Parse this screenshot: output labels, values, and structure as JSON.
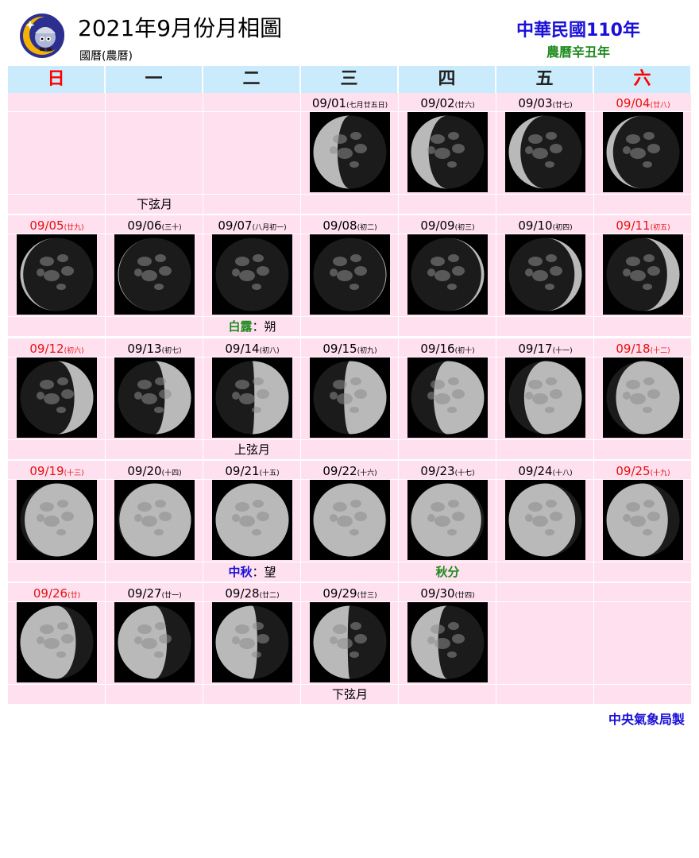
{
  "header": {
    "title": "2021年9月份月相圖",
    "subtitle": "國曆(農曆)",
    "roc_year": "中華民國110年",
    "lunar_year": "農曆辛丑年"
  },
  "weekdays": [
    {
      "label": "日",
      "weekend": true
    },
    {
      "label": "一",
      "weekend": false
    },
    {
      "label": "二",
      "weekend": false
    },
    {
      "label": "三",
      "weekend": false
    },
    {
      "label": "四",
      "weekend": false
    },
    {
      "label": "五",
      "weekend": false
    },
    {
      "label": "六",
      "weekend": true
    }
  ],
  "colors": {
    "header_bg": "#c9ebfb",
    "cell_bg": "#ffe0ef",
    "weekend_red": "#e81010",
    "title_blue": "#1a10d8",
    "green": "#1e8a1e"
  },
  "weeks": [
    [
      {
        "date": "",
        "lunar": "",
        "illum": null,
        "waxing": null,
        "event": ""
      },
      {
        "date": "",
        "lunar": "",
        "illum": null,
        "waxing": null,
        "event": "下弦月"
      },
      {
        "date": "",
        "lunar": "",
        "illum": null,
        "waxing": null,
        "event": ""
      },
      {
        "date": "09/01",
        "lunar": "七月廿五日",
        "illum": 0.33,
        "waxing": false,
        "event": ""
      },
      {
        "date": "09/02",
        "lunar": "廿六",
        "illum": 0.24,
        "waxing": false,
        "event": ""
      },
      {
        "date": "09/03",
        "lunar": "廿七",
        "illum": 0.16,
        "waxing": false,
        "event": ""
      },
      {
        "date": "09/04",
        "lunar": "廿八",
        "illum": 0.09,
        "waxing": false,
        "event": ""
      }
    ],
    [
      {
        "date": "09/05",
        "lunar": "廿九",
        "illum": 0.04,
        "waxing": false,
        "event": ""
      },
      {
        "date": "09/06",
        "lunar": "三十",
        "illum": 0.01,
        "waxing": false,
        "event": ""
      },
      {
        "date": "09/07",
        "lunar": "八月初一",
        "illum": 0.0,
        "waxing": true,
        "event": "朔",
        "event_hl": "白露",
        "event_hl_color": "#1e8a1e"
      },
      {
        "date": "09/08",
        "lunar": "初二",
        "illum": 0.01,
        "waxing": true,
        "event": ""
      },
      {
        "date": "09/09",
        "lunar": "初三",
        "illum": 0.04,
        "waxing": true,
        "event": ""
      },
      {
        "date": "09/10",
        "lunar": "初四",
        "illum": 0.1,
        "waxing": true,
        "event": ""
      },
      {
        "date": "09/11",
        "lunar": "初五",
        "illum": 0.17,
        "waxing": true,
        "event": ""
      }
    ],
    [
      {
        "date": "09/12",
        "lunar": "初六",
        "illum": 0.26,
        "waxing": true,
        "event": ""
      },
      {
        "date": "09/13",
        "lunar": "初七",
        "illum": 0.36,
        "waxing": true,
        "event": ""
      },
      {
        "date": "09/14",
        "lunar": "初八",
        "illum": 0.47,
        "waxing": true,
        "event": "上弦月"
      },
      {
        "date": "09/15",
        "lunar": "初九",
        "illum": 0.58,
        "waxing": true,
        "event": ""
      },
      {
        "date": "09/16",
        "lunar": "初十",
        "illum": 0.69,
        "waxing": true,
        "event": ""
      },
      {
        "date": "09/17",
        "lunar": "十一",
        "illum": 0.79,
        "waxing": true,
        "event": ""
      },
      {
        "date": "09/18",
        "lunar": "十二",
        "illum": 0.87,
        "waxing": true,
        "event": ""
      }
    ],
    [
      {
        "date": "09/19",
        "lunar": "十三",
        "illum": 0.94,
        "waxing": true,
        "event": ""
      },
      {
        "date": "09/20",
        "lunar": "十四",
        "illum": 0.98,
        "waxing": true,
        "event": ""
      },
      {
        "date": "09/21",
        "lunar": "十五",
        "illum": 1.0,
        "waxing": true,
        "event": "望",
        "event_hl": "中秋",
        "event_hl_color": "#1a10d8"
      },
      {
        "date": "09/22",
        "lunar": "十六",
        "illum": 0.99,
        "waxing": false,
        "event": ""
      },
      {
        "date": "09/23",
        "lunar": "十七",
        "illum": 0.96,
        "waxing": false,
        "event": "",
        "event_hl": "秋分",
        "event_hl_color": "#1e8a1e"
      },
      {
        "date": "09/24",
        "lunar": "十八",
        "illum": 0.91,
        "waxing": false,
        "event": ""
      },
      {
        "date": "09/25",
        "lunar": "十九",
        "illum": 0.84,
        "waxing": false,
        "event": ""
      }
    ],
    [
      {
        "date": "09/26",
        "lunar": "廿",
        "illum": 0.76,
        "waxing": false,
        "event": ""
      },
      {
        "date": "09/27",
        "lunar": "廿一",
        "illum": 0.67,
        "waxing": false,
        "event": ""
      },
      {
        "date": "09/28",
        "lunar": "廿二",
        "illum": 0.57,
        "waxing": false,
        "event": ""
      },
      {
        "date": "09/29",
        "lunar": "廿三",
        "illum": 0.47,
        "waxing": false,
        "event": "下弦月"
      },
      {
        "date": "09/30",
        "lunar": "廿四",
        "illum": 0.37,
        "waxing": false,
        "event": ""
      },
      {
        "date": "",
        "lunar": "",
        "illum": null,
        "waxing": null,
        "event": ""
      },
      {
        "date": "",
        "lunar": "",
        "illum": null,
        "waxing": null,
        "event": ""
      }
    ]
  ],
  "footer": {
    "credit": "中央氣象局製"
  }
}
